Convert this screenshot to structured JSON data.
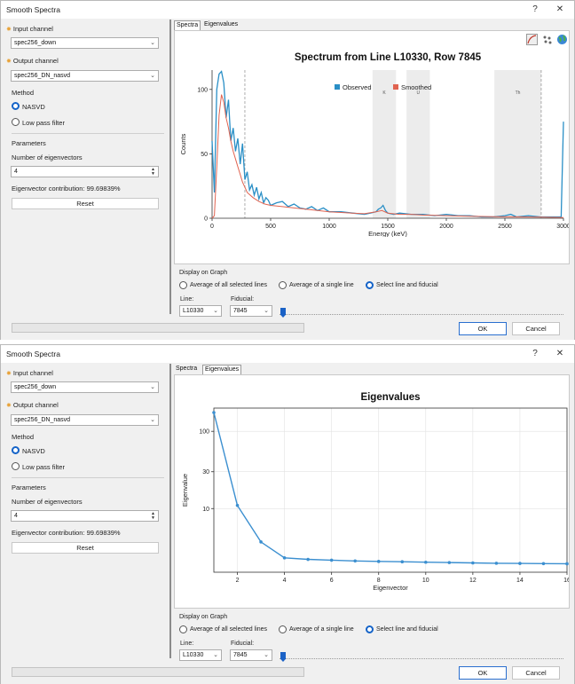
{
  "dialogs": [
    {
      "title": "Smooth Spectra",
      "help": "?",
      "close": "✕",
      "input_label": "Input channel",
      "input_value": "spec256_down",
      "output_label": "Output channel",
      "output_value": "spec256_DN_nasvd",
      "method_label": "Method",
      "method_options": [
        "NASVD",
        "Low pass filter"
      ],
      "params_label": "Parameters",
      "num_eig_label": "Number of eigenvectors",
      "num_eig_value": "4",
      "contribution": "Eigenvector contribution: 99.69839%",
      "reset": "Reset",
      "tabs": [
        "Spectra",
        "Eigenvalues"
      ],
      "active_tab": 0,
      "display_label": "Display on Graph",
      "display_options": [
        "Average of all selected lines",
        "Average of a single line",
        "Select line and fiducial"
      ],
      "line_label": "Line:",
      "line_value": "L10330",
      "fid_label": "Fiducial:",
      "fid_value": "7845",
      "ok": "OK",
      "cancel": "Cancel"
    },
    {
      "title": "Smooth Spectra",
      "help": "?",
      "close": "✕",
      "input_label": "Input channel",
      "input_value": "spec256_down",
      "output_label": "Output channel",
      "output_value": "spec256_DN_nasvd",
      "method_label": "Method",
      "method_options": [
        "NASVD",
        "Low pass filter"
      ],
      "params_label": "Parameters",
      "num_eig_label": "Number of eigenvectors",
      "num_eig_value": "4",
      "contribution": "Eigenvector contribution: 99.69839%",
      "reset": "Reset",
      "tabs": [
        "Spectra",
        "Eigenvalues"
      ],
      "active_tab": 1,
      "display_label": "Display on Graph",
      "display_options": [
        "Average of all selected lines",
        "Average of a single line",
        "Select line and fiducial"
      ],
      "line_label": "Line:",
      "line_value": "L10330",
      "fid_label": "Fiducial:",
      "fid_value": "7845",
      "ok": "OK",
      "cancel": "Cancel"
    }
  ],
  "chart_data": [
    {
      "type": "line",
      "title": "Spectrum from Line L10330, Row 7845",
      "xlabel": "Energy (keV)",
      "ylabel": "Counts",
      "xlim": [
        0,
        3000
      ],
      "ylim": [
        0,
        115
      ],
      "xticks": [
        0,
        500,
        1000,
        1500,
        2000,
        2500,
        3000
      ],
      "yticks": [
        0,
        50,
        100
      ],
      "legend_position": "top-center",
      "windows": [
        {
          "name": "K",
          "range": [
            1370,
            1570
          ]
        },
        {
          "name": "U",
          "range": [
            1660,
            1860
          ]
        },
        {
          "name": "Th",
          "range": [
            2410,
            2810
          ]
        }
      ],
      "markers": [
        280,
        2810
      ],
      "series": [
        {
          "name": "Observed",
          "color": "#2a8fc6",
          "x": [
            0,
            20,
            40,
            60,
            80,
            100,
            120,
            140,
            160,
            180,
            200,
            220,
            240,
            260,
            280,
            300,
            320,
            340,
            360,
            380,
            400,
            420,
            440,
            460,
            480,
            500,
            550,
            600,
            650,
            700,
            750,
            800,
            850,
            900,
            950,
            1000,
            1100,
            1200,
            1300,
            1350,
            1400,
            1420,
            1440,
            1460,
            1480,
            1500,
            1550,
            1600,
            1700,
            1800,
            1900,
            2000,
            2100,
            2200,
            2300,
            2400,
            2500,
            2550,
            2600,
            2700,
            2800,
            2900,
            2980,
            3000
          ],
          "y": [
            60,
            20,
            100,
            112,
            114,
            105,
            78,
            92,
            60,
            70,
            52,
            62,
            42,
            58,
            30,
            36,
            22,
            26,
            18,
            24,
            15,
            20,
            12,
            16,
            14,
            10,
            12,
            13,
            9,
            11,
            8,
            7,
            9,
            6,
            8,
            5,
            5,
            4,
            3,
            4,
            5,
            7,
            8,
            10,
            6,
            4,
            3,
            4,
            3,
            3,
            2,
            3,
            2,
            2,
            1,
            1,
            2,
            3,
            1,
            2,
            1,
            1,
            1,
            75
          ]
        },
        {
          "name": "Smoothed",
          "color": "#e06350",
          "x": [
            0,
            20,
            40,
            60,
            80,
            100,
            120,
            140,
            160,
            180,
            200,
            220,
            240,
            260,
            280,
            300,
            350,
            400,
            450,
            500,
            600,
            700,
            800,
            900,
            1000,
            1100,
            1200,
            1300,
            1400,
            1450,
            1500,
            1600,
            1700,
            1800,
            2000,
            2200,
            2400,
            2600,
            2800,
            3000
          ],
          "y": [
            0,
            2,
            40,
            80,
            96,
            90,
            78,
            70,
            60,
            52,
            46,
            40,
            34,
            28,
            24,
            20,
            16,
            13,
            11,
            10,
            9,
            8,
            7,
            6,
            5,
            4.5,
            4,
            3.5,
            5,
            6,
            4,
            3,
            3,
            2.5,
            2,
            1.5,
            1.2,
            1,
            0.8,
            0.5
          ]
        }
      ]
    },
    {
      "type": "line",
      "title": "Eigenvalues",
      "xlabel": "Eigenvector",
      "ylabel": "Eigenvalue",
      "yscale": "log",
      "xlim": [
        1,
        16
      ],
      "ylim": [
        1.5,
        200
      ],
      "xticks": [
        2,
        4,
        6,
        8,
        10,
        12,
        14,
        16
      ],
      "yticks": [
        10,
        30,
        100
      ],
      "series": [
        {
          "name": "",
          "color": "#3b8fd0",
          "x": [
            1,
            2,
            3,
            4,
            5,
            6,
            7,
            8,
            9,
            10,
            11,
            12,
            13,
            14,
            15,
            16
          ],
          "y": [
            175,
            11,
            3.7,
            2.3,
            2.2,
            2.15,
            2.1,
            2.07,
            2.05,
            2.02,
            2.0,
            1.98,
            1.96,
            1.95,
            1.94,
            1.93
          ]
        }
      ]
    }
  ]
}
